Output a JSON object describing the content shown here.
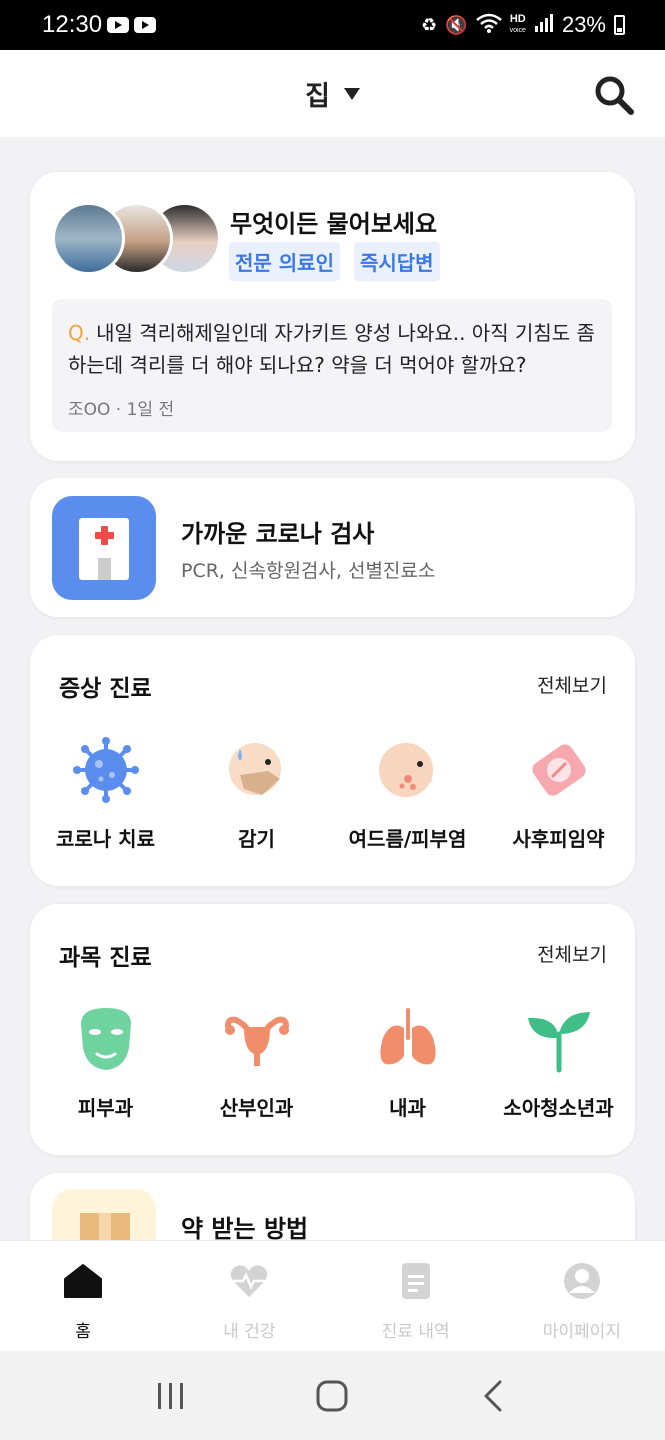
{
  "status_bar": {
    "time": "12:30",
    "battery": "23%"
  },
  "header": {
    "location": "집"
  },
  "qa_card": {
    "title": "무엇이든 물어보세요",
    "tags": [
      "전문 의료인",
      "즉시답변"
    ],
    "question_prefix": "Q.",
    "question": "내일 격리해제일인데 자가키트 양성 나와요.. 아직 기침도 좀 하는데 격리를 더 해야 되나요? 약을 더 먹어야 할까요?",
    "meta": "조OO · 1일 전"
  },
  "covid_card": {
    "title": "가까운 코로나 검사",
    "subtitle": "PCR, 신속항원검사, 선별진료소"
  },
  "symptom_section": {
    "title": "증상 진료",
    "view_all": "전체보기",
    "items": [
      {
        "label": "코로나 치료",
        "icon": "virus-icon"
      },
      {
        "label": "감기",
        "icon": "cold-mask-icon"
      },
      {
        "label": "여드름/피부염",
        "icon": "acne-face-icon"
      },
      {
        "label": "사후피임약",
        "icon": "pill-pack-icon"
      }
    ]
  },
  "department_section": {
    "title": "과목 진료",
    "view_all": "전체보기",
    "items": [
      {
        "label": "피부과",
        "icon": "face-mask-icon"
      },
      {
        "label": "산부인과",
        "icon": "uterus-icon"
      },
      {
        "label": "내과",
        "icon": "lungs-icon"
      },
      {
        "label": "소아청소년과",
        "icon": "sprout-icon"
      }
    ]
  },
  "medicine_card": {
    "title": "약 받는 방법"
  },
  "bottom_nav": {
    "items": [
      {
        "label": "홈",
        "icon": "home-icon",
        "active": true
      },
      {
        "label": "내 건강",
        "icon": "heart-pulse-icon",
        "active": false
      },
      {
        "label": "진료 내역",
        "icon": "document-icon",
        "active": false
      },
      {
        "label": "마이페이지",
        "icon": "profile-icon",
        "active": false
      }
    ]
  },
  "colors": {
    "accent_blue": "#5b8def",
    "tag_text": "#3b78e7",
    "question_mark": "#f2a23c",
    "department_green": "#6fd3a0",
    "organ_salmon": "#f28d6c"
  }
}
